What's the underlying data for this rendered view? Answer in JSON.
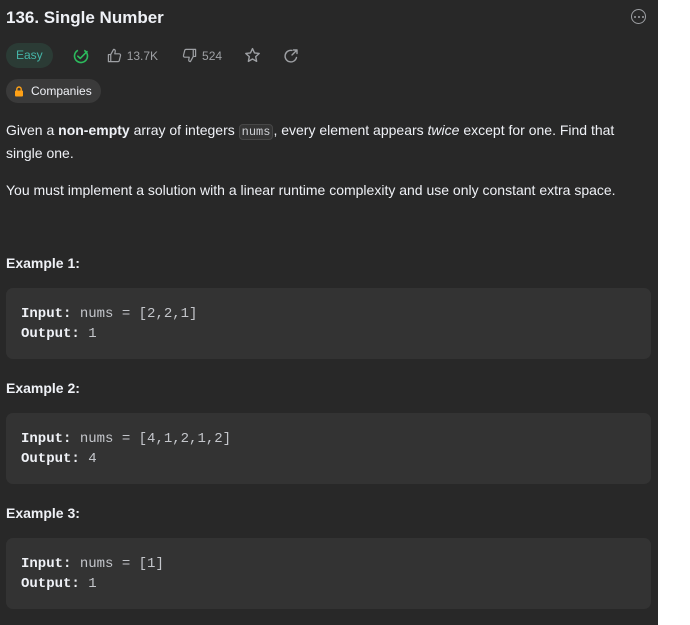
{
  "problem": {
    "title": "136. Single Number",
    "difficulty": "Easy",
    "likes": "13.7K",
    "dislikes": "524",
    "companies_label": "Companies"
  },
  "description": {
    "p1_a": "Given a ",
    "p1_b": "non-empty",
    "p1_c": " array of integers ",
    "p1_code": "nums",
    "p1_d": ", every element appears ",
    "p1_e": "twice",
    "p1_f": " except for one. Find that single one.",
    "p2": "You must implement a solution with a linear runtime complexity and use only constant extra space."
  },
  "examples": [
    {
      "title": "Example 1:",
      "input_label": "Input:",
      "input": "nums = [2,2,1]",
      "output_label": "Output:",
      "output": "1"
    },
    {
      "title": "Example 2:",
      "input_label": "Input:",
      "input": "nums = [4,1,2,1,2]",
      "output_label": "Output:",
      "output": "4"
    },
    {
      "title": "Example 3:",
      "input_label": "Input:",
      "input": "nums = [1]",
      "output_label": "Output:",
      "output": "1"
    }
  ],
  "icons": {
    "solved": "check-circle-icon",
    "like": "thumbs-up-icon",
    "dislike": "thumbs-down-icon",
    "favorite": "star-icon",
    "share": "share-icon",
    "more": "more-options-icon",
    "companies": "lock-icon"
  },
  "colors": {
    "panel_bg": "#282828",
    "easy_text": "#45b5a8",
    "easy_bg": "#2b3b35",
    "solved_green": "#2cbb5d",
    "lock_orange": "#ffa116",
    "code_bg": "#333333"
  }
}
